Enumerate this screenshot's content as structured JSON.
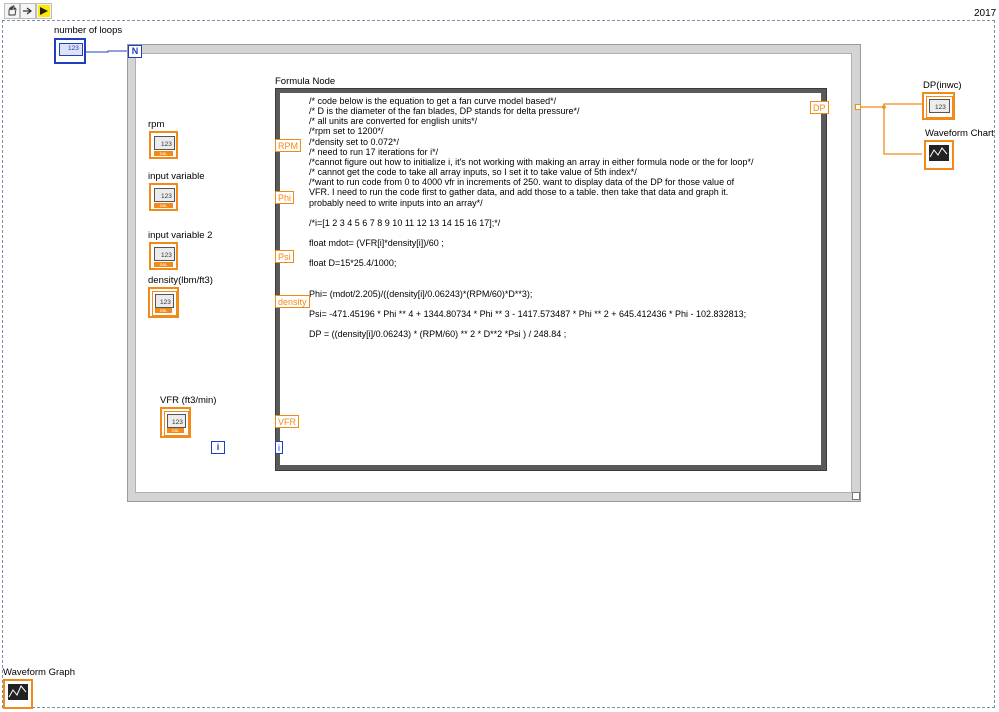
{
  "toolbar": {
    "buttons": [
      {
        "name": "hand-tool-icon"
      },
      {
        "name": "arrow-tool-icon"
      },
      {
        "name": "run-icon"
      }
    ],
    "version": "2017"
  },
  "colors": {
    "wire_orange": "#f08a18",
    "wire_blue": "#1f3fbf",
    "loop_frame": "#d4d4d4",
    "formula_frame": "#5a5a5a"
  },
  "controls": {
    "number_of_loops": "number of loops",
    "rpm": "rpm",
    "input_variable": "input variable",
    "input_variable_2": "input variable 2",
    "density": "density(lbm/ft3)",
    "vfr": "VFR (ft3/min)",
    "waveform_graph": "Waveform Graph",
    "num_glyph": "123",
    "dbl_glyph": "DBL"
  },
  "loop": {
    "count_terminal": "N",
    "iteration_terminal": "i"
  },
  "formula_node": {
    "label": "Formula Node",
    "inputs": [
      "RPM",
      "Phi",
      "Psi",
      "density",
      "VFR",
      "i"
    ],
    "output": "DP",
    "code": [
      "/* code below is the equation to get a fan curve model based*/",
      "/* D is the diameter of the fan blades, DP stands for delta pressure*/",
      "/* all units are converted for english units*/",
      "/*rpm set to 1200*/",
      "/*density set to 0.072*/",
      "/* need to run 17 iterations for i*/",
      "/*cannot figure out how to initialize i, it's not working with making an array in either formula node or the for loop*/",
      "/* cannot get the code to take all array inputs, so I set it to take value of 5th index*/",
      "/*want to run code from 0 to 4000 vfr in increments of 250. want to display data of the DP for those value of",
      "VFR. I need to run the code first to gather data, and add those to a table. then take that data and graph it.",
      " probably need to write inputs into an array*/",
      "",
      "/*i=[1 2 3 4 5 6 7 8 9 10 11 12 13 14 15 16 17];*/",
      "",
      "float mdot= (VFR[i]*density[i])/60 ;",
      "",
      "float D=15*25.4/1000;",
      "",
      "",
      "Phi= (mdot/2.205)/((density[i]/0.06243)*(RPM/60)*D**3);",
      "",
      "Psi= -471.45196 * Phi ** 4 + 1344.80734 * Phi ** 3 - 1417.573487 * Phi ** 2 + 645.412436 * Phi - 102.832813;",
      "",
      "DP = ((density[i]/0.06243) * (RPM/60) ** 2 * D**2 *Psi ) / 248.84 ;"
    ]
  },
  "indicators": {
    "dp": "DP(inwc)",
    "waveform_chart": "Waveform Chart"
  }
}
